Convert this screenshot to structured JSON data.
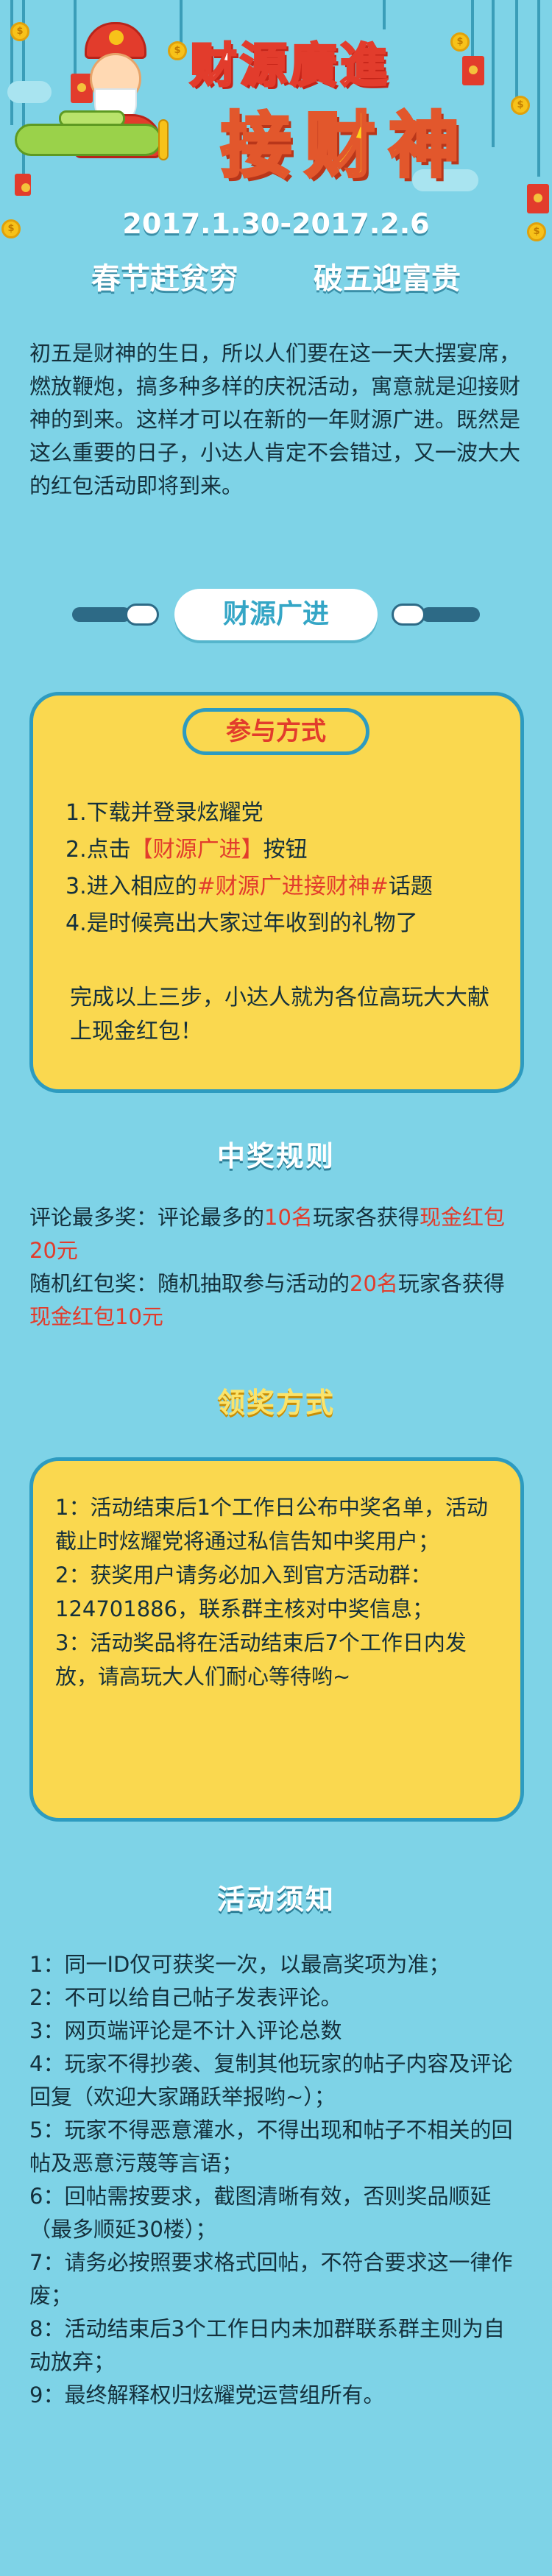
{
  "header": {
    "title_top": "财源廣進",
    "title_main": "接财神",
    "dates": "2017.1.30-2017.2.6",
    "slogan_left": "春节赶贫穷",
    "slogan_right": "破五迎富贵",
    "coin_glyph": "$"
  },
  "intro": "初五是财神的生日，所以人们要在这一天大摆宴席，燃放鞭炮，搞多种多样的庆祝活动，寓意就是迎接财神的到来。这样才可以在新的一年财源广进。既然是这么重要的日子，小达人肯定不会错过，又一波大大的红包活动即将到来。",
  "event_pill": "财源广进",
  "participate": {
    "heading": "参与方式",
    "steps": [
      {
        "num": "1.",
        "a": "下载并登录炫耀党",
        "hl": "",
        "b": ""
      },
      {
        "num": "2.",
        "a": "点击",
        "hl": "【财源广进】",
        "b": "按钮"
      },
      {
        "num": "3.",
        "a": "进入相应的",
        "hl": "#财源广进接财神#",
        "b": "话题"
      },
      {
        "num": "4.",
        "a": "是时候亮出大家过年收到的礼物了",
        "hl": "",
        "b": ""
      }
    ],
    "after": "完成以上三步，小达人就为各位高玩大大献上现金红包！"
  },
  "prize_rules": {
    "heading": "中奖规则",
    "r1_a": "评论最多奖：评论最多的",
    "r1_num": "10名",
    "r1_b": "玩家各获得",
    "r1_prize": "现金红包20元",
    "r2_a": "随机红包奖：随机抽取参与活动的",
    "r2_num": "20名",
    "r2_b": "玩家各获得",
    "r2_prize": "现金红包10元"
  },
  "claim": {
    "heading": "领奖方式",
    "items": [
      "1：活动结束后1个工作日公布中奖名单，活动截止时炫耀党将通过私信告知中奖用户；",
      "2：获奖用户请务必加入到官方活动群：124701886，联系群主核对中奖信息；",
      "3：活动奖品将在活动结束后7个工作日内发放，请高玩大人们耐心等待哟~"
    ]
  },
  "notes": {
    "heading": "活动须知",
    "items": [
      "1：同一ID仅可获奖一次，以最高奖项为准；",
      "2：不可以给自己帖子发表评论。",
      "3：网页端评论是不计入评论总数",
      "4：玩家不得抄袭、复制其他玩家的帖子内容及评论回复（欢迎大家踊跃举报哟~）；",
      "5：玩家不得恶意灌水，不得出现和帖子不相关的回帖及恶意污蔑等言语；",
      "6：回帖需按要求，截图清晰有效，否则奖品顺延（最多顺延30楼）；",
      "7：请务必按照要求格式回帖，不符合要求这一律作废；",
      "8：活动结束后3个工作日内未加群联系群主则为自动放弃；",
      "9：最终解释权归炫耀党运营组所有。"
    ]
  },
  "colors": {
    "background": "#7ed3e7",
    "box_yellow": "#fad84f",
    "border_blue": "#2d9bc0",
    "highlight_red": "#e23c2c"
  }
}
